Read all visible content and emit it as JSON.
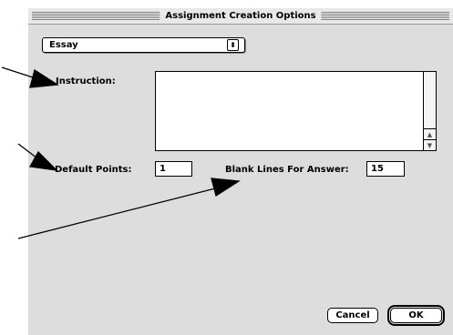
{
  "window": {
    "title": "Assignment Creation Options"
  },
  "question_type": {
    "selected": "Essay"
  },
  "instruction": {
    "label": "Instruction:",
    "value": ""
  },
  "default_points": {
    "label": "Default Points:",
    "value": "1"
  },
  "blank_lines": {
    "label": "Blank Lines For Answer:",
    "value": "15"
  },
  "buttons": {
    "cancel": "Cancel",
    "ok": "OK"
  },
  "icons": {
    "popup": "updown-arrows-icon",
    "scroll_up": "scroll-up-arrow-icon",
    "scroll_down": "scroll-down-arrow-icon"
  }
}
